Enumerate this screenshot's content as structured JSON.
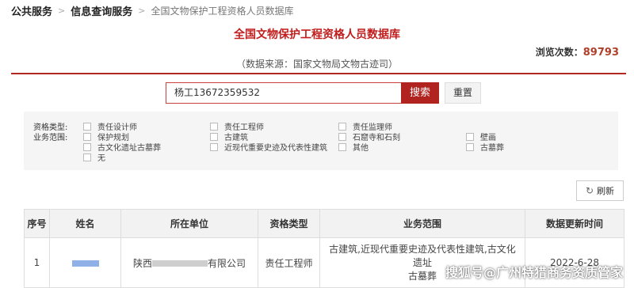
{
  "breadcrumb": {
    "level1": "公共服务",
    "level2": "信息查询服务",
    "current": "全国文物保护工程资格人员数据库",
    "separator": ">"
  },
  "page": {
    "title": "全国文物保护工程资格人员数据库",
    "views_label": "浏览次数：",
    "views_count": "89793",
    "source": "（数据来源：国家文物局文物古迹司）"
  },
  "search": {
    "value": "杨工13672359532",
    "button_label": "搜索",
    "reset_label": "重置"
  },
  "filters": {
    "qual_label": "资格类型:",
    "scope_label": "业务范围:",
    "qualification_types": [
      "责任设计师",
      "责任工程师",
      "责任监理师"
    ],
    "business_scope": [
      "保护规划",
      "古建筑",
      "石窟寺和石刻",
      "壁画",
      "古文化遗址古墓葬",
      "近现代重要史迹及代表性建筑",
      "其他",
      "古墓葬",
      "无"
    ]
  },
  "refresh_label": "刷新",
  "table": {
    "headers": [
      "序号",
      "姓名",
      "所在单位",
      "资格类型",
      "业务范围",
      "数据更新时间"
    ],
    "rows": [
      {
        "index": "1",
        "unit_prefix": "陕西",
        "unit_suffix": "有限公司",
        "qual_type": "责任工程师",
        "scope_line1": "古建筑,近现代重要史迹及代表性建筑,古文化遗址",
        "scope_line2": "古墓葬",
        "updated": "2022-6-28"
      }
    ]
  },
  "watermark": "搜狐号@广州特猎商务资质管家"
}
